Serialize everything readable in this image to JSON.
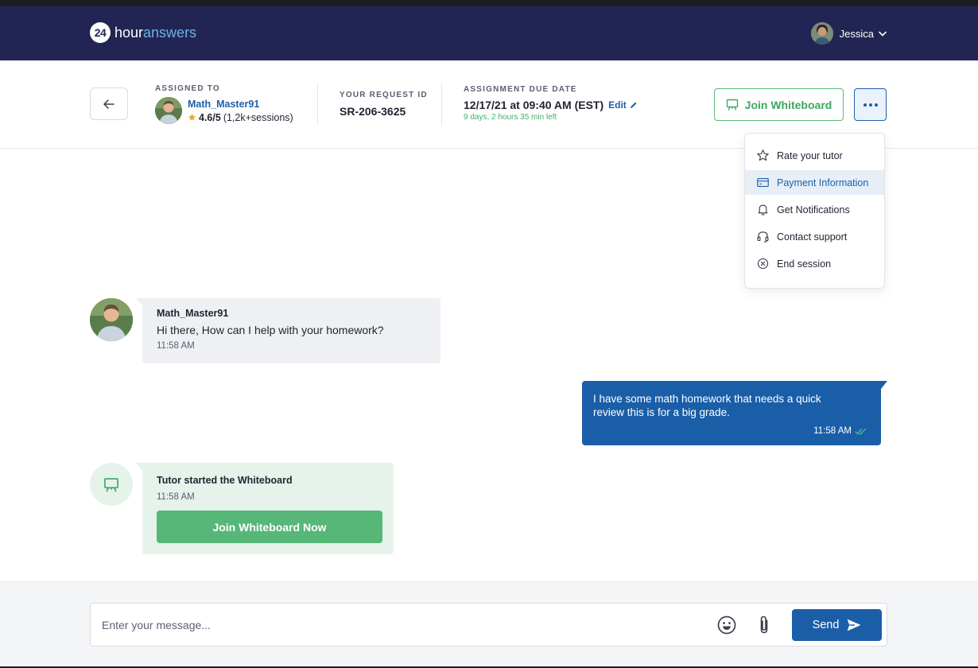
{
  "header": {
    "logo_number": "24",
    "logo_word1": "hour",
    "logo_word2": "answers",
    "user_name": "Jessica"
  },
  "session_info": {
    "assigned_label": "ASSIGNED TO",
    "tutor_name": "Math_Master91",
    "rating": "4.6/5",
    "sessions": "(1,2k+sessions)",
    "request_label": "YOUR REQUEST ID",
    "request_id": "SR-206-3625",
    "due_label": "ASSIGNMENT DUE DATE",
    "due_date": "12/17/21 at 09:40 AM (EST)",
    "edit_label": "Edit",
    "time_left": "9 days, 2 hours 35 min left",
    "join_whiteboard_label": "Join Whiteboard"
  },
  "menu": {
    "items": [
      {
        "label": "Rate your tutor",
        "icon": "star-icon"
      },
      {
        "label": "Payment Information",
        "icon": "credit-card-icon",
        "active": true
      },
      {
        "label": "Get Notifications",
        "icon": "bell-icon"
      },
      {
        "label": "Contact support",
        "icon": "headset-icon"
      },
      {
        "label": "End session",
        "icon": "close-circle-icon"
      }
    ]
  },
  "messages": {
    "tutor_msg": {
      "author": "Math_Master91",
      "text": "Hi there, How can I help with your homework?",
      "time": "11:58 AM"
    },
    "user_msg": {
      "text": "I have some math homework that needs a quick review this is for a big grade.",
      "time": "11:58 AM"
    },
    "whiteboard_msg": {
      "title": "Tutor started the Whiteboard",
      "time": "11:58 AM",
      "button_label": "Join Whiteboard Now"
    }
  },
  "composer": {
    "placeholder": "Enter your message...",
    "send_label": "Send"
  },
  "colors": {
    "navbar": "#222553",
    "primary_blue": "#1a5ea8",
    "green": "#56b778",
    "star": "#f0a030"
  }
}
